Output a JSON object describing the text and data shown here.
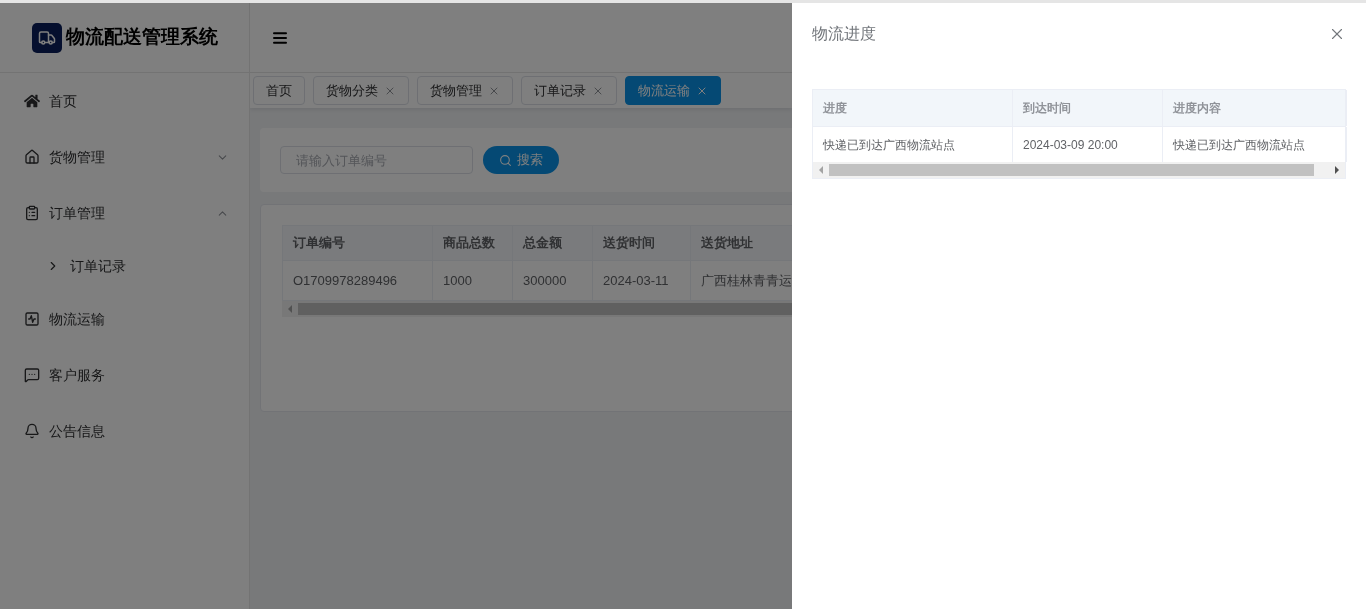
{
  "brand": {
    "title": "物流配送管理系统"
  },
  "sidebar": {
    "items": [
      {
        "label": "首页"
      },
      {
        "label": "货物管理",
        "expanded": false
      },
      {
        "label": "订单管理",
        "expanded": true,
        "children": [
          {
            "label": "订单记录"
          }
        ]
      },
      {
        "label": "物流运输"
      },
      {
        "label": "客户服务"
      },
      {
        "label": "公告信息"
      }
    ]
  },
  "tabs": [
    {
      "label": "首页",
      "selected": false,
      "closable": false
    },
    {
      "label": "货物分类",
      "selected": false,
      "closable": true
    },
    {
      "label": "货物管理",
      "selected": false,
      "closable": true
    },
    {
      "label": "订单记录",
      "selected": false,
      "closable": true
    },
    {
      "label": "物流运输",
      "selected": true,
      "closable": true
    }
  ],
  "search": {
    "placeholder": "请输入订单编号",
    "button": "搜索"
  },
  "orders_table": {
    "columns": [
      "订单编号",
      "商品总数",
      "总金额",
      "送货时间",
      "送货地址"
    ],
    "rows": [
      [
        "O1709978289496",
        "1000",
        "300000",
        "2024-03-11",
        "广西桂林青青运"
      ]
    ]
  },
  "drawer": {
    "title": "物流进度",
    "table": {
      "columns": [
        "进度",
        "到达时间",
        "进度内容"
      ],
      "rows": [
        [
          "快递已到达广西物流站点",
          "2024-03-09 20:00",
          "快递已到达广西物流站点"
        ]
      ]
    }
  }
}
